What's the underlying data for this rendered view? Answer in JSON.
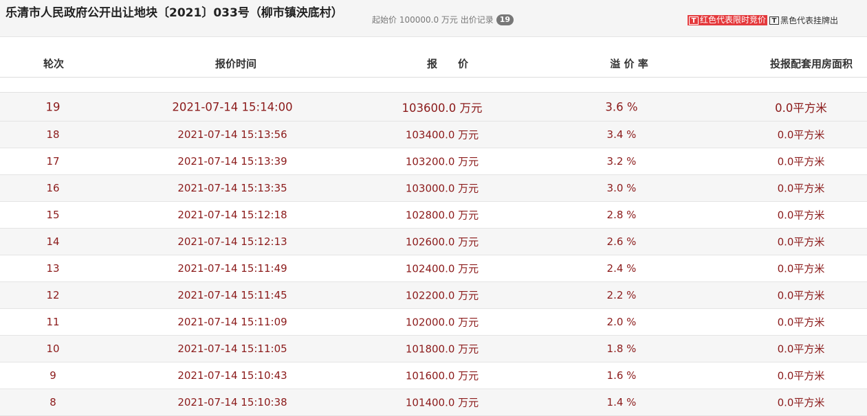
{
  "header": {
    "title": "乐清市人民政府公开出让地块〔2021〕033号（柳市镇泱底村）",
    "start_price_text": "起始价 100000.0 万元 出价记录",
    "bid_count": "19"
  },
  "legend": {
    "red_icon": "T",
    "red_label": "红色代表限时竞价",
    "black_icon": "T",
    "black_label": "黑色代表挂牌出"
  },
  "table": {
    "columns": [
      "轮次",
      "报价时间",
      "报　　价",
      "溢 价 率",
      "投报配套用房面积"
    ],
    "rows": [
      {
        "round": "19",
        "time": "2021-07-14 15:14:00",
        "price": "103600.0 万元",
        "rate": "3.6 %",
        "area": "0.0平方米"
      },
      {
        "round": "18",
        "time": "2021-07-14 15:13:56",
        "price": "103400.0 万元",
        "rate": "3.4 %",
        "area": "0.0平方米"
      },
      {
        "round": "17",
        "time": "2021-07-14 15:13:39",
        "price": "103200.0 万元",
        "rate": "3.2 %",
        "area": "0.0平方米"
      },
      {
        "round": "16",
        "time": "2021-07-14 15:13:35",
        "price": "103000.0 万元",
        "rate": "3.0 %",
        "area": "0.0平方米"
      },
      {
        "round": "15",
        "time": "2021-07-14 15:12:18",
        "price": "102800.0 万元",
        "rate": "2.8 %",
        "area": "0.0平方米"
      },
      {
        "round": "14",
        "time": "2021-07-14 15:12:13",
        "price": "102600.0 万元",
        "rate": "2.6 %",
        "area": "0.0平方米"
      },
      {
        "round": "13",
        "time": "2021-07-14 15:11:49",
        "price": "102400.0 万元",
        "rate": "2.4 %",
        "area": "0.0平方米"
      },
      {
        "round": "12",
        "time": "2021-07-14 15:11:45",
        "price": "102200.0 万元",
        "rate": "2.2 %",
        "area": "0.0平方米"
      },
      {
        "round": "11",
        "time": "2021-07-14 15:11:09",
        "price": "102000.0 万元",
        "rate": "2.0 %",
        "area": "0.0平方米"
      },
      {
        "round": "10",
        "time": "2021-07-14 15:11:05",
        "price": "101800.0 万元",
        "rate": "1.8 %",
        "area": "0.0平方米"
      },
      {
        "round": "9",
        "time": "2021-07-14 15:10:43",
        "price": "101600.0 万元",
        "rate": "1.6 %",
        "area": "0.0平方米"
      },
      {
        "round": "8",
        "time": "2021-07-14 15:10:38",
        "price": "101400.0 万元",
        "rate": "1.4 %",
        "area": "0.0平方米"
      }
    ]
  },
  "colors": {
    "row_text": "#8b1a1a",
    "legend_red": "#e4393c",
    "badge_bg": "#777777"
  }
}
